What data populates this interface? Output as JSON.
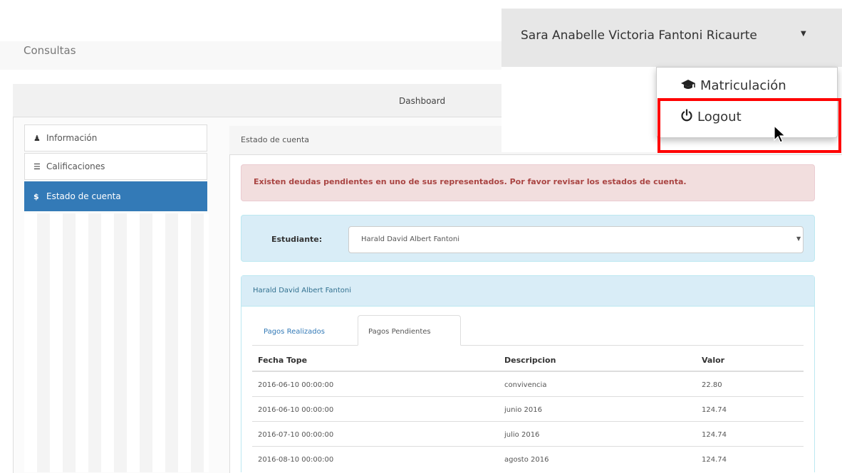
{
  "navbar": {
    "brand": "Consultas"
  },
  "dashboard": {
    "title": "Dashboard"
  },
  "sidebar": {
    "items": [
      {
        "label": "Información",
        "icon": "user-icon",
        "active": false
      },
      {
        "label": "Calificaciones",
        "icon": "list-icon",
        "active": false
      },
      {
        "label": "Estado de cuenta",
        "icon": "dollar-icon",
        "active": true
      }
    ]
  },
  "estado": {
    "title": "Estado de cuenta",
    "alert": "Existen deudas pendientes en uno de sus representados. Por favor revisar los estados de cuenta.",
    "student_label": "Estudiante:",
    "student_selected": "Harald David Albert Fantoni",
    "panel_title": "Harald David Albert Fantoni",
    "tabs": [
      "Pagos Realizados",
      "Pagos Pendientes"
    ],
    "active_tab": "Pagos Pendientes",
    "columns": [
      "Fecha Tope",
      "Descripcion",
      "Valor"
    ],
    "rows": [
      [
        "2016-06-10 00:00:00",
        "convivencia",
        "22.80"
      ],
      [
        "2016-06-10 00:00:00",
        "junio 2016",
        "124.74"
      ],
      [
        "2016-07-10 00:00:00",
        "julio 2016",
        "124.74"
      ],
      [
        "2016-08-10 00:00:00",
        "agosto 2016",
        "124.74"
      ]
    ]
  },
  "user_menu": {
    "username": "Sara Anabelle Victoria Fantoni Ricaurte",
    "items": [
      {
        "label": "Matriculación",
        "icon": "graduation-cap-icon"
      },
      {
        "label": "Logout",
        "icon": "power-icon"
      }
    ],
    "highlight_color": "#ff0000"
  },
  "colors": {
    "primary": "#337ab7",
    "alert_text": "#a94442",
    "info_bg": "#d9edf7"
  }
}
